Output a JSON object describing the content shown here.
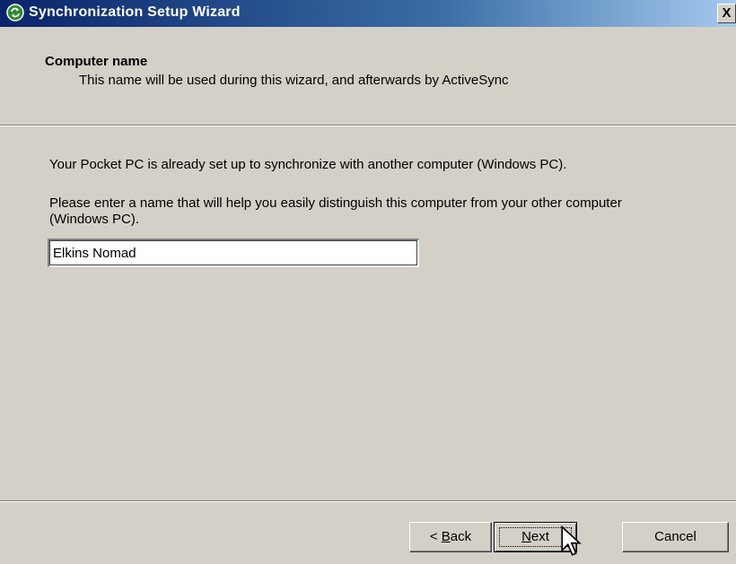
{
  "window": {
    "title": "Synchronization Setup Wizard",
    "close_label": "X"
  },
  "header": {
    "title": "Computer name",
    "subtitle": "This name will be used during this wizard, and afterwards by ActiveSync"
  },
  "body": {
    "line1": "Your Pocket PC is already set up to synchronize with another computer (Windows PC).",
    "line2": "Please enter a name that will help you easily distinguish this computer from your other computer (Windows PC)."
  },
  "name_field": {
    "value": "Elkins Nomad"
  },
  "buttons": {
    "back_prefix": "< ",
    "back_mnemonic": "B",
    "back_rest": "ack",
    "next_mnemonic": "N",
    "next_rest": "ext",
    "cancel": "Cancel"
  },
  "colors": {
    "titlebar_start": "#0a246a",
    "titlebar_end": "#a6caf0",
    "dialog_bg": "#d4d0c8"
  },
  "icons": [
    "sync-icon",
    "close-icon",
    "arrow-cursor-icon"
  ]
}
